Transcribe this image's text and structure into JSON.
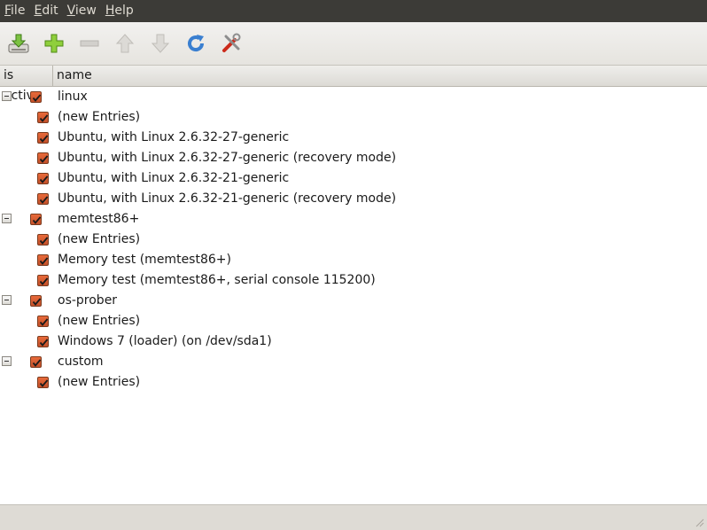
{
  "menubar": {
    "items": [
      {
        "label": "File",
        "mnemonic": "F",
        "rest": "ile"
      },
      {
        "label": "Edit",
        "mnemonic": "E",
        "rest": "dit"
      },
      {
        "label": "View",
        "mnemonic": "V",
        "rest": "iew"
      },
      {
        "label": "Help",
        "mnemonic": "H",
        "rest": "elp"
      }
    ]
  },
  "toolbar": {
    "buttons": [
      {
        "icon": "save-icon",
        "enabled": true
      },
      {
        "icon": "add-icon",
        "enabled": true
      },
      {
        "icon": "remove-icon",
        "enabled": false
      },
      {
        "icon": "move-up-icon",
        "enabled": false
      },
      {
        "icon": "move-down-icon",
        "enabled": false
      },
      {
        "icon": "reload-icon",
        "enabled": true
      },
      {
        "icon": "preferences-icon",
        "enabled": true
      }
    ]
  },
  "columns": {
    "active": "is active",
    "name": "name"
  },
  "tree": {
    "groups": [
      {
        "name": "linux",
        "checked": true,
        "expanded": true,
        "children": [
          {
            "name": "(new Entries)",
            "checked": true
          },
          {
            "name": "Ubuntu, with Linux 2.6.32-27-generic",
            "checked": true
          },
          {
            "name": "Ubuntu, with Linux 2.6.32-27-generic (recovery mode)",
            "checked": true
          },
          {
            "name": "Ubuntu, with Linux 2.6.32-21-generic",
            "checked": true
          },
          {
            "name": "Ubuntu, with Linux 2.6.32-21-generic (recovery mode)",
            "checked": true
          }
        ]
      },
      {
        "name": "memtest86+",
        "checked": true,
        "expanded": true,
        "children": [
          {
            "name": "(new Entries)",
            "checked": true
          },
          {
            "name": "Memory test (memtest86+)",
            "checked": true
          },
          {
            "name": "Memory test (memtest86+, serial console 115200)",
            "checked": true
          }
        ]
      },
      {
        "name": "os-prober",
        "checked": true,
        "expanded": true,
        "children": [
          {
            "name": "(new Entries)",
            "checked": true
          },
          {
            "name": "Windows 7 (loader) (on /dev/sda1)",
            "checked": true
          }
        ]
      },
      {
        "name": "custom",
        "checked": true,
        "expanded": true,
        "children": [
          {
            "name": "(new Entries)",
            "checked": true
          }
        ]
      }
    ]
  },
  "statusbar": {
    "text": ""
  }
}
